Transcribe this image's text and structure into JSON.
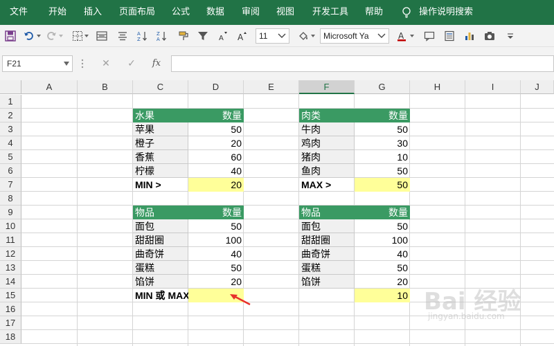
{
  "menu": {
    "items": [
      "文件",
      "开始",
      "插入",
      "页面布局",
      "公式",
      "数据",
      "审阅",
      "视图",
      "开发工具",
      "帮助"
    ],
    "tell_me": "操作说明搜索"
  },
  "toolbar": {
    "font_size": "11",
    "font_name": "Microsoft Ya"
  },
  "formula_bar": {
    "name_box": "F21",
    "cancel_glyph": "✕",
    "enter_glyph": "✓",
    "fx_label": "fx",
    "formula": ""
  },
  "sheet": {
    "columns": [
      "A",
      "B",
      "C",
      "D",
      "E",
      "F",
      "G",
      "H",
      "I",
      "J"
    ],
    "selected_column": "F",
    "rows": [
      "1",
      "2",
      "3",
      "4",
      "5",
      "6",
      "7",
      "8",
      "9",
      "10",
      "11",
      "12",
      "13",
      "14",
      "15",
      "16",
      "17",
      "18"
    ],
    "selected_row": "21"
  },
  "tables": {
    "fruit": {
      "header_item": "水果",
      "header_qty": "数量",
      "rows": [
        {
          "item": "苹果",
          "qty": "50"
        },
        {
          "item": "橙子",
          "qty": "20"
        },
        {
          "item": "香蕉",
          "qty": "60"
        },
        {
          "item": "柠檬",
          "qty": "40"
        }
      ],
      "result_label": "MIN >",
      "result_value": "20"
    },
    "meat": {
      "header_item": "肉类",
      "header_qty": "数量",
      "rows": [
        {
          "item": "牛肉",
          "qty": "50"
        },
        {
          "item": "鸡肉",
          "qty": "30"
        },
        {
          "item": "猪肉",
          "qty": "10"
        },
        {
          "item": "鱼肉",
          "qty": "50"
        }
      ],
      "result_label": "MAX >",
      "result_value": "50"
    },
    "goods_left": {
      "header_item": "物品",
      "header_qty": "数量",
      "rows": [
        {
          "item": "面包",
          "qty": "50"
        },
        {
          "item": "甜甜圈",
          "qty": "100"
        },
        {
          "item": "曲奇饼",
          "qty": "40"
        },
        {
          "item": "蛋糕",
          "qty": "50"
        },
        {
          "item": "馅饼",
          "qty": "20"
        }
      ],
      "result_label": "MIN 或 MAX >",
      "result_value": ""
    },
    "goods_right": {
      "header_item": "物品",
      "header_qty": "数量",
      "rows": [
        {
          "item": "面包",
          "qty": "50"
        },
        {
          "item": "甜甜圈",
          "qty": "100"
        },
        {
          "item": "曲奇饼",
          "qty": "40"
        },
        {
          "item": "蛋糕",
          "qty": "50"
        },
        {
          "item": "馅饼",
          "qty": "20"
        }
      ],
      "result_value": "10"
    }
  },
  "watermark": {
    "text": "Bai 经验",
    "sub": "jingyan.baidu.com"
  },
  "colors": {
    "ribbon": "#217346",
    "table_header": "#3a9a63",
    "highlight": "#ffff99",
    "arrow": "#e8312c"
  }
}
